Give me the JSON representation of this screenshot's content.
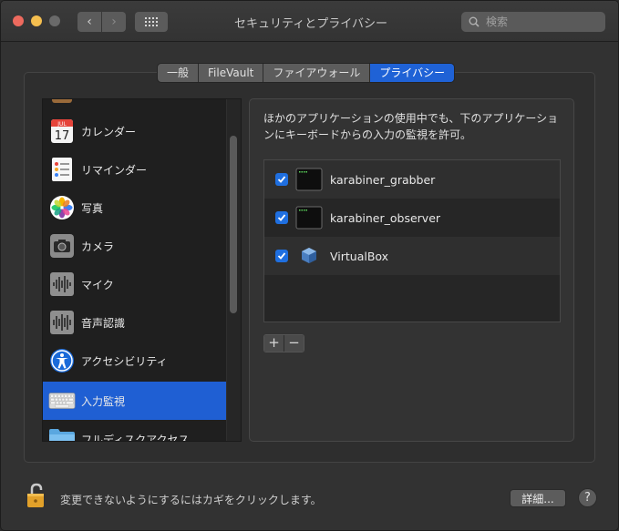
{
  "window": {
    "title": "セキュリティとプライバシー"
  },
  "search": {
    "placeholder": "検索"
  },
  "tabs": [
    {
      "label": "一般",
      "active": false
    },
    {
      "label": "FileVault",
      "active": false
    },
    {
      "label": "ファイアウォール",
      "active": false
    },
    {
      "label": "プライバシー",
      "active": true
    }
  ],
  "sidebar": {
    "items": [
      {
        "label": "カレンダー",
        "icon": "calendar-icon",
        "calendar_month": "JUL",
        "calendar_day": "17"
      },
      {
        "label": "リマインダー",
        "icon": "reminders-icon"
      },
      {
        "label": "写真",
        "icon": "photos-icon"
      },
      {
        "label": "カメラ",
        "icon": "camera-icon"
      },
      {
        "label": "マイク",
        "icon": "microphone-icon"
      },
      {
        "label": "音声認識",
        "icon": "speech-recognition-icon"
      },
      {
        "label": "アクセシビリティ",
        "icon": "accessibility-icon"
      },
      {
        "label": "入力監視",
        "icon": "keyboard-icon",
        "selected": true
      },
      {
        "label": "フルディスクアクセス",
        "icon": "folder-icon"
      }
    ]
  },
  "detail": {
    "description": "ほかのアプリケーションの使用中でも、下のアプリケーションにキーボードからの入力の監視を許可。",
    "apps": [
      {
        "name": "karabiner_grabber",
        "checked": true,
        "icon": "terminal-icon"
      },
      {
        "name": "karabiner_observer",
        "checked": true,
        "icon": "terminal-icon"
      },
      {
        "name": "VirtualBox",
        "checked": true,
        "icon": "virtualbox-icon"
      }
    ],
    "add_label": "+",
    "remove_label": "−"
  },
  "footer": {
    "lock_text": "変更できないようにするにはカギをクリックします。",
    "advanced_label": "詳細...",
    "help_label": "?"
  },
  "colors": {
    "accent": "#1f62d6",
    "window_bg": "#323232"
  }
}
